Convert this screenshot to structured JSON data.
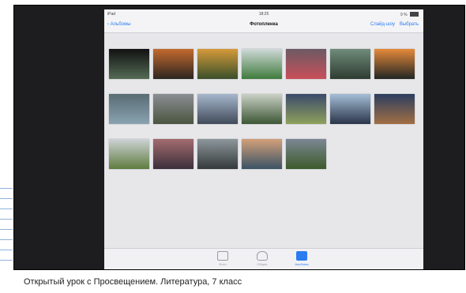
{
  "status_bar": {
    "carrier": "iPad",
    "time": "18:25",
    "battery": "9 % "
  },
  "nav": {
    "back_label": "Альбомы",
    "title": "Фотопленка",
    "slideshow_label": "Слайд-шоу",
    "select_label": "Выбрать"
  },
  "tabs": [
    {
      "label": "Фото",
      "icon": "photos-tab-icon"
    },
    {
      "label": "Общие",
      "icon": "cloud-tab-icon"
    },
    {
      "label": "Альбомы",
      "icon": "albums-tab-icon"
    }
  ],
  "photos": [
    {
      "c1": "#111",
      "c2": "#546b55"
    },
    {
      "c1": "#c46a2e",
      "c2": "#2c2520"
    },
    {
      "c1": "#d49a3a",
      "c2": "#3a4f2a"
    },
    {
      "c1": "#cfd9d8",
      "c2": "#3f7b3c"
    },
    {
      "c1": "#6c5a64",
      "c2": "#c94f59"
    },
    {
      "c1": "#6f8b7a",
      "c2": "#2e3c31"
    },
    {
      "c1": "#e6893a",
      "c2": "#212623"
    },
    {
      "c1": "#586c74",
      "c2": "#8aa2b0"
    },
    {
      "c1": "#8a8e92",
      "c2": "#4b5540"
    },
    {
      "c1": "#a6b7cc",
      "c2": "#404a59"
    },
    {
      "c1": "#cad1c6",
      "c2": "#3c5634"
    },
    {
      "c1": "#3b4a6a",
      "c2": "#8ea15c"
    },
    {
      "c1": "#a4bed7",
      "c2": "#2a3448"
    },
    {
      "c1": "#2c3e60",
      "c2": "#a26f44"
    },
    {
      "c1": "#cdd3d6",
      "c2": "#5f7c3f"
    },
    {
      "c1": "#a36c6f",
      "c2": "#3b2f3b"
    },
    {
      "c1": "#8d979c",
      "c2": "#34393a"
    },
    {
      "c1": "#d3a07a",
      "c2": "#3a5365"
    },
    {
      "c1": "#7c8794",
      "c2": "#3d5a2a"
    }
  ],
  "caption": "Открытый урок с Просвещением. Литература, 7 класс"
}
